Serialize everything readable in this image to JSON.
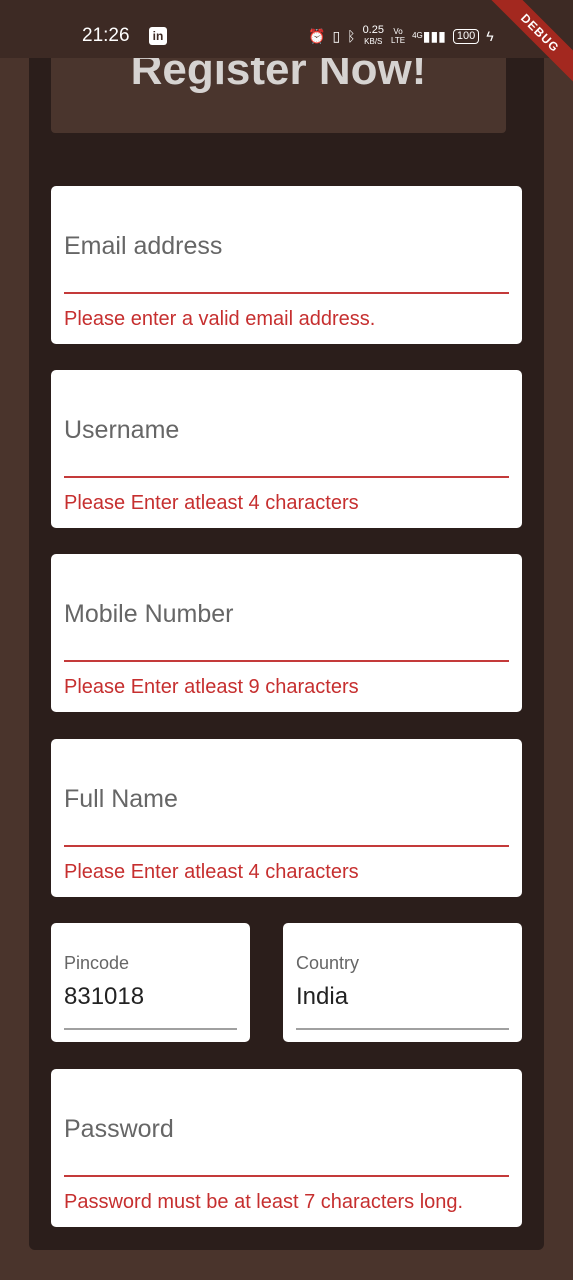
{
  "status_bar": {
    "time": "21:26",
    "app_icon": "linkedin-icon",
    "net_speed": "0.25",
    "net_unit": "KB/S",
    "volte_line1": "Vo",
    "volte_line2": "LTE",
    "signal_label": "4G",
    "battery": "100"
  },
  "debug_banner": "DEBUG",
  "title": "Register Now!",
  "fields": {
    "email": {
      "label": "Email address",
      "error": "Please enter a valid email address."
    },
    "username": {
      "label": "Username",
      "error": "Please Enter atleast 4 characters"
    },
    "mobile": {
      "label": "Mobile Number",
      "error": "Please Enter atleast 9 characters"
    },
    "full_name": {
      "label": "Full Name",
      "error": "Please Enter atleast 4 characters"
    },
    "pincode": {
      "label": "Pincode",
      "value": "831018"
    },
    "country": {
      "label": "Country",
      "value": "India"
    },
    "password": {
      "label": "Password",
      "error": "Password must be at least 7 characters long."
    }
  },
  "colors": {
    "background": "#4a342c",
    "panel": "#2b1e1b",
    "error": "#c62f2f"
  }
}
